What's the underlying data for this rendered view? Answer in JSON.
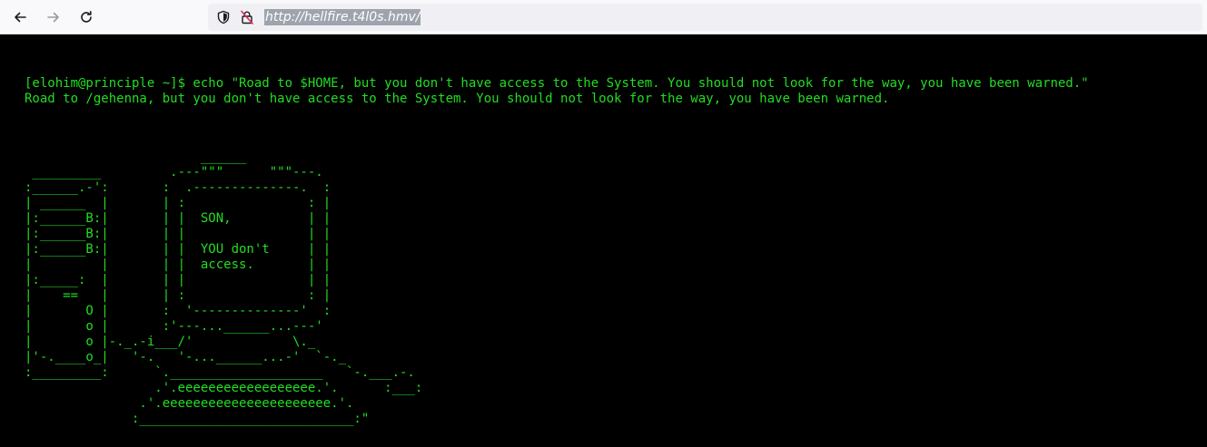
{
  "browser": {
    "url": "http://hellfire.t4l0s.hmv/",
    "icons": {
      "back": "arrow-left-icon",
      "forward": "arrow-right-icon",
      "reload": "reload-icon",
      "tracking": "shield-icon",
      "security": "insecure-lock-icon"
    }
  },
  "terminal": {
    "command_line": "[elohim@principle ~]$ echo \"Road to $HOME, but you don't have access to the System. You should not look for the way, you have been warned.\"",
    "output_line": "Road to /gehenna, but you don't have access to the System. You should not look for the way, you have been warned.",
    "ascii_art": "                       ______\n _________         .---\"\"\"      \"\"\"---.\n:______.-':       :  .--------------.  :\n| ______  |       | :                : |\n|:______B:|       | |  SON,          | |\n|:______B:|       | |                | |\n|:______B:|       | |  YOU don't     | |\n|         |       | |  access.       | |\n|:_____:  |       | |                | |\n|    ==   |       | :                : |\n|       O |       :  '--------------'  :\n|       o |       :'---...______...---'\n|       o |-._.-i___/'             \\._\n|'-.____o_|   '-.   '-...______...-'  `-._\n:_________:      `.____________________   `-.___.-.\n                 .'.eeeeeeeeeeeeeeeeee.'.      :___:\n               .'.eeeeeeeeeeeeeeeeeeeeee.'.\n              :____________________________:\"",
    "colors": {
      "background": "#000000",
      "text": "#22dd22"
    }
  }
}
